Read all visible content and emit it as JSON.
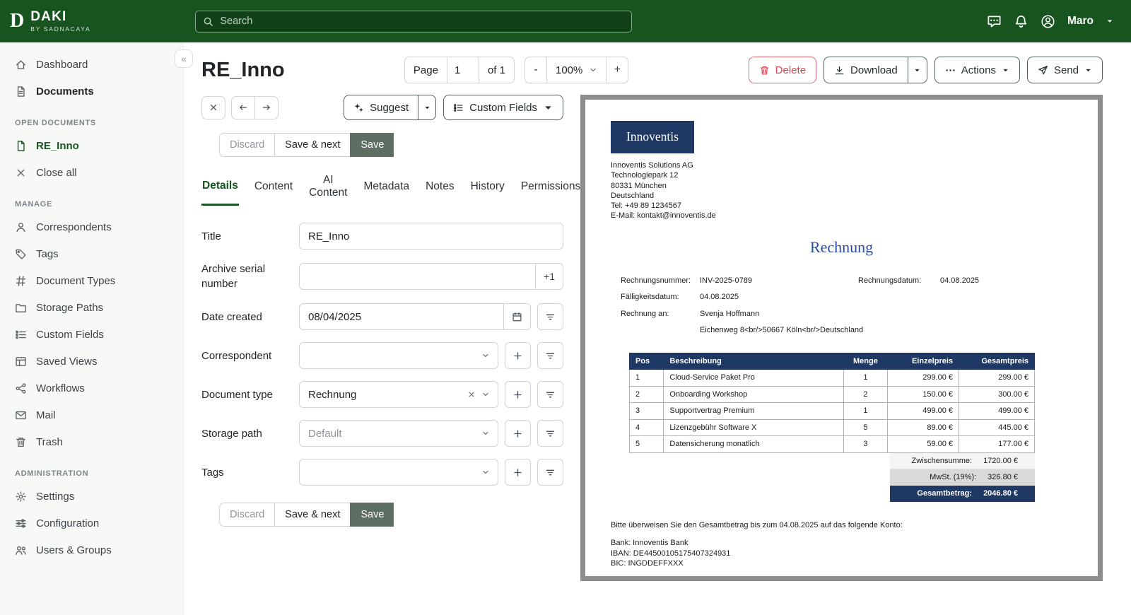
{
  "topbar": {
    "logo": "D",
    "brand": "DAKI",
    "brand_sub": "BY SADNACAYA",
    "search_placeholder": "Search",
    "user": "Maro"
  },
  "sidebar": {
    "main": [
      {
        "label": "Dashboard",
        "icon": "home-icon"
      },
      {
        "label": "Documents",
        "icon": "documents-icon",
        "bold": true
      }
    ],
    "open_documents": {
      "header": "OPEN DOCUMENTS",
      "items": [
        {
          "label": "RE_Inno",
          "icon": "file-icon",
          "active": true
        },
        {
          "label": "Close all",
          "icon": "close-icon"
        }
      ]
    },
    "manage": {
      "header": "MANAGE",
      "items": [
        {
          "label": "Correspondents",
          "icon": "person-icon"
        },
        {
          "label": "Tags",
          "icon": "tag-icon"
        },
        {
          "label": "Document Types",
          "icon": "hash-icon"
        },
        {
          "label": "Storage Paths",
          "icon": "folder-icon"
        },
        {
          "label": "Custom Fields",
          "icon": "custom-fields-icon"
        },
        {
          "label": "Saved Views",
          "icon": "saved-views-icon"
        },
        {
          "label": "Workflows",
          "icon": "workflows-icon"
        },
        {
          "label": "Mail",
          "icon": "mail-icon"
        },
        {
          "label": "Trash",
          "icon": "trash-icon"
        }
      ]
    },
    "administration": {
      "header": "ADMINISTRATION",
      "items": [
        {
          "label": "Settings",
          "icon": "gear-icon"
        },
        {
          "label": "Configuration",
          "icon": "configuration-icon"
        },
        {
          "label": "Users & Groups",
          "icon": "users-groups-icon"
        }
      ]
    }
  },
  "header": {
    "title": "RE_Inno",
    "page_label": "Page",
    "page_value": "1",
    "page_of": "of 1",
    "zoom_minus": "-",
    "zoom_value": "100%",
    "zoom_plus": "+",
    "delete": "Delete",
    "download": "Download",
    "actions": "Actions",
    "send": "Send"
  },
  "toolbar": {
    "suggest": "Suggest",
    "custom_fields": "Custom Fields"
  },
  "save_bar": {
    "buttons": [
      {
        "label": "Discard",
        "style": "discard"
      },
      {
        "label": "Save & next",
        "style": "next"
      },
      {
        "label": "Save",
        "style": "save"
      }
    ]
  },
  "tabs": [
    {
      "label": "Details",
      "active": true
    },
    {
      "label": "Content"
    },
    {
      "label": "AI Content"
    },
    {
      "label": "Metadata"
    },
    {
      "label": "Notes"
    },
    {
      "label": "History"
    },
    {
      "label": "Permissions"
    }
  ],
  "form": {
    "title": {
      "label": "Title",
      "value": "RE_Inno"
    },
    "asn": {
      "label": "Archive serial number",
      "value": "",
      "button": "+1"
    },
    "date_created": {
      "label": "Date created",
      "value": "08/04/2025"
    },
    "correspondent": {
      "label": "Correspondent",
      "value": ""
    },
    "document_type": {
      "label": "Document type",
      "value": "Rechnung"
    },
    "storage_path": {
      "label": "Storage path",
      "placeholder": "Default"
    },
    "tags": {
      "label": "Tags",
      "value": ""
    }
  },
  "invoice": {
    "logo_text": "Innoventis",
    "sender_lines": [
      "Innoventis Solutions AG",
      "Technologiepark 12",
      "80331 München",
      "Deutschland",
      "Tel: +49 89 1234567",
      "E-Mail: kontakt@innoventis.de"
    ],
    "title": "Rechnung",
    "meta": {
      "invoice_no_label": "Rechnungsnummer:",
      "invoice_no": "INV-2025-0789",
      "date_label": "Rechnungsdatum:",
      "date": "04.08.2025",
      "due_label": "Fälligkeitsdatum:",
      "due": "04.08.2025",
      "recipient_label": "Rechnung an:",
      "recipient": "Svenja Hoffmann",
      "recipient_address": "Eichenweg 8<br/>50667 Köln<br/>Deutschland"
    },
    "table": {
      "headers": [
        "Pos",
        "Beschreibung",
        "Menge",
        "Einzelpreis",
        "Gesamtpreis"
      ],
      "rows": [
        {
          "pos": "1",
          "desc": "Cloud-Service Paket Pro",
          "qty": "1",
          "unit": "299.00 €",
          "total": "299.00 €"
        },
        {
          "pos": "2",
          "desc": "Onboarding Workshop",
          "qty": "2",
          "unit": "150.00 €",
          "total": "300.00 €"
        },
        {
          "pos": "3",
          "desc": "Supportvertrag Premium",
          "qty": "1",
          "unit": "499.00 €",
          "total": "499.00 €"
        },
        {
          "pos": "4",
          "desc": "Lizenzgebühr Software X",
          "qty": "5",
          "unit": "89.00 €",
          "total": "445.00 €"
        },
        {
          "pos": "5",
          "desc": "Datensicherung monatlich",
          "qty": "3",
          "unit": "59.00 €",
          "total": "177.00 €"
        }
      ]
    },
    "totals": [
      {
        "label": "Zwischensumme:",
        "value": "1720.00 €",
        "style": "light"
      },
      {
        "label": "MwSt. (19%):",
        "value": "326.80 €",
        "style": "mid"
      },
      {
        "label": "Gesamtbetrag:",
        "value": "2046.80 €",
        "style": "dark"
      }
    ],
    "payment_note": "Bitte überweisen Sie den Gesamtbetrag bis zum 04.08.2025 auf das folgende Konto:",
    "bank_lines": [
      "Bank: Innoventis Bank",
      "IBAN: DE44500105175407324931",
      "BIC: INGDDEFFXXX"
    ]
  },
  "colors": {
    "brand_green": "#17541f",
    "invoice_navy": "#1f3864",
    "invoice_blue": "#2a4d9e",
    "danger_red": "#dc3545",
    "save_button": "#5d6e62"
  }
}
